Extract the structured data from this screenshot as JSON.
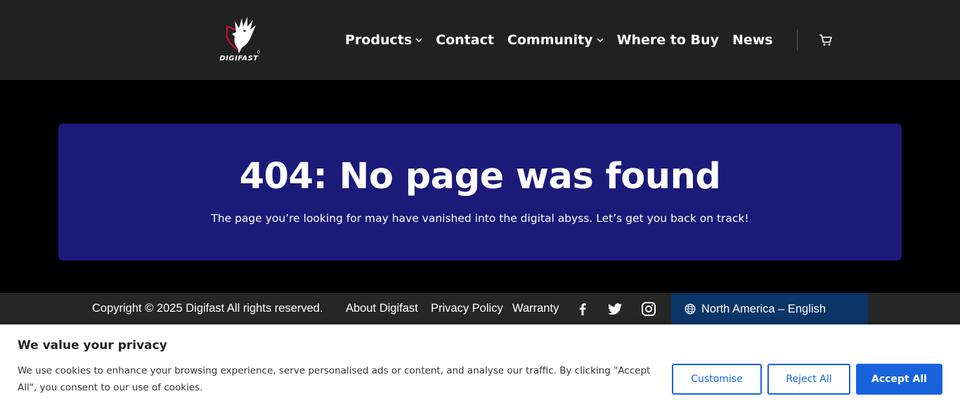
{
  "header": {
    "logo_text": "DIGIFAST",
    "nav": [
      {
        "label": "Products",
        "has_dropdown": true
      },
      {
        "label": "Contact",
        "has_dropdown": false
      },
      {
        "label": "Community",
        "has_dropdown": true
      },
      {
        "label": "Where to Buy",
        "has_dropdown": false
      },
      {
        "label": "News",
        "has_dropdown": false
      }
    ],
    "cart_icon": "cart-icon"
  },
  "hero": {
    "title": "404: No page was found",
    "subtitle": "The page you’re looking for may have vanished into the digital abyss. Let’s get you back on track!"
  },
  "footer": {
    "copyright": "Copyright © 2025 Digifast All rights reserved.",
    "links": [
      "About Digifast",
      "Privacy Policy",
      "Warranty"
    ],
    "social": [
      "facebook-icon",
      "twitter-icon",
      "instagram-icon"
    ],
    "region": "North America – English"
  },
  "cookie_banner": {
    "title": "We value your privacy",
    "text": "We use cookies to enhance your browsing experience, serve personalised ads or content, and analyse our traffic. By clicking \"Accept All\", you consent to our use of cookies.",
    "customise_label": "Customise",
    "reject_label": "Reject All",
    "accept_label": "Accept All"
  },
  "colors": {
    "header_bg": "#212121",
    "hero_bg": "#1b1a78",
    "region_bg": "#0a3566",
    "accent": "#1863dc"
  }
}
